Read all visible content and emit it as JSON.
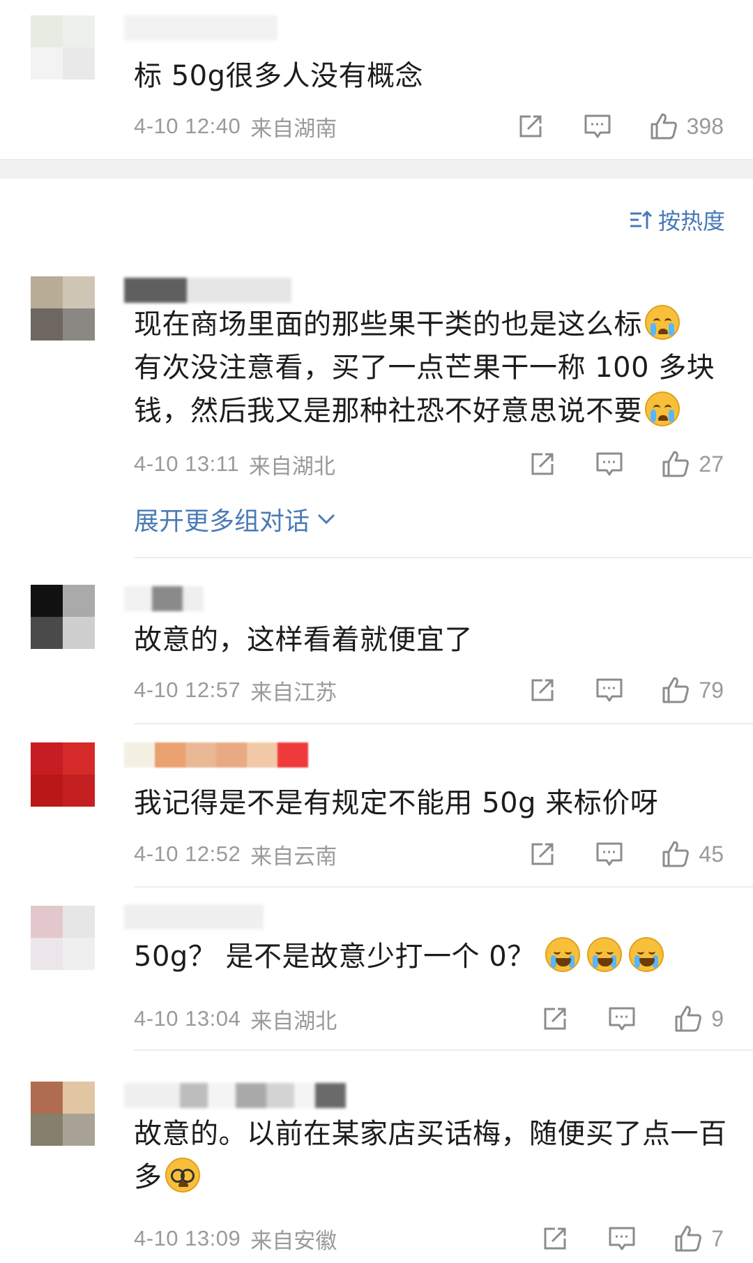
{
  "sort": {
    "label": "按热度"
  },
  "expand_label": "展开更多组对话",
  "comments": [
    {
      "text": "标 50g很多人没有概念",
      "time": "4-10 12:40",
      "location": "来自湖南",
      "likes": "398"
    },
    {
      "text_parts": [
        "现在商场里面的那些果干类的也是这么标",
        "有次没注意看，买了一点芒果干一称 100 多块钱，然后我又是那种社恐不好意思说不要"
      ],
      "time": "4-10 13:11",
      "location": "来自湖北",
      "likes": "27"
    },
    {
      "text": "故意的，这样看着就便宜了",
      "time": "4-10 12:57",
      "location": "来自江苏",
      "likes": "79"
    },
    {
      "text": "我记得是不是有规定不能用 50g 来标价呀",
      "time": "4-10 12:52",
      "location": "来自云南",
      "likes": "45"
    },
    {
      "text": "50g？ 是不是故意少打一个 0？",
      "time": "4-10 13:04",
      "location": "来自湖北",
      "likes": "9"
    },
    {
      "text": "故意的。以前在某家店买话梅，随便买了点一百多",
      "time": "4-10 13:09",
      "location": "来自安徽",
      "likes": "7"
    }
  ],
  "icons": {
    "share": "share-icon",
    "comment": "comment-icon",
    "like": "thumbs-up-icon",
    "sort": "sort-icon",
    "expand": "chevron-down-icon",
    "emoji_cry": "crying-face-emoji",
    "emoji_laugh": "laughing-face-emoji",
    "emoji_glasses": "glasses-face-emoji"
  },
  "colors": {
    "link": "#4a7ab6",
    "text": "#1c1c1c",
    "meta": "#9a9a9a"
  }
}
